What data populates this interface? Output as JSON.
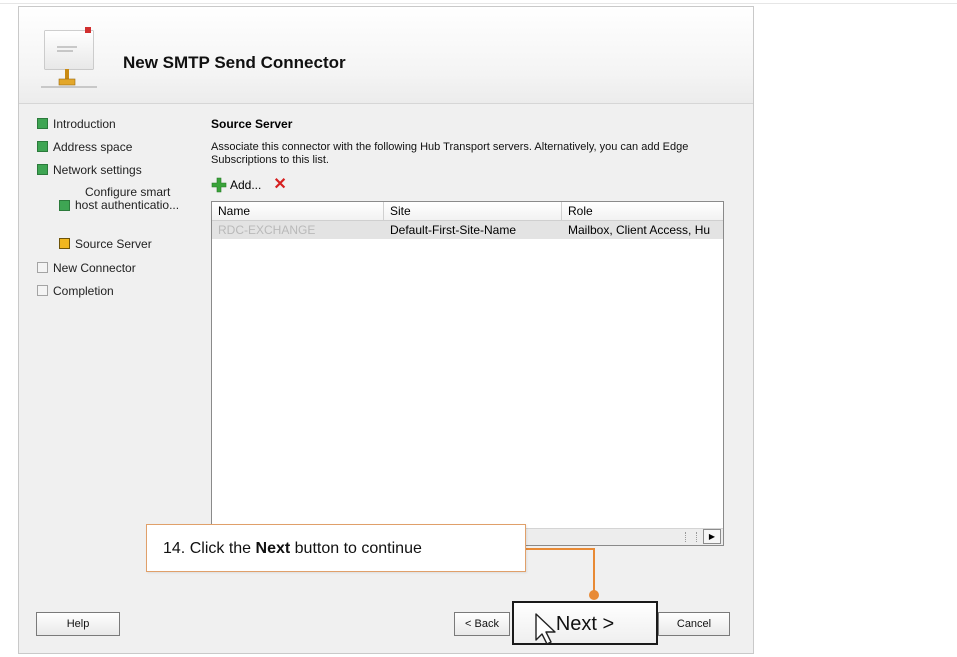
{
  "wizard": {
    "title": "New SMTP Send Connector"
  },
  "nav": {
    "items": [
      {
        "label": "Introduction",
        "state": "done"
      },
      {
        "label": "Address space",
        "state": "done"
      },
      {
        "label": "Network settings",
        "state": "done"
      },
      {
        "label": "Configure smart host authenticatio...",
        "label_line1": "Configure smart",
        "label_line2": "host authenticatio...",
        "state": "done"
      },
      {
        "label": "Source Server",
        "state": "current"
      },
      {
        "label": "New Connector",
        "state": "pending"
      },
      {
        "label": "Completion",
        "state": "pending"
      }
    ]
  },
  "page": {
    "section_title": "Source Server",
    "description": "Associate this connector with the following Hub Transport servers. Alternatively, you can add Edge Subscriptions to this list.",
    "add_label": "Add...",
    "remove_icon": "x-icon",
    "columns": [
      "Name",
      "Site",
      "Role"
    ],
    "rows": [
      {
        "name": "RDC-EXCHANGE",
        "site": "Default-First-Site-Name",
        "role": "Mailbox, Client Access, Hu"
      }
    ]
  },
  "callout": {
    "step": "14.",
    "text_before": "Click the",
    "bold": "Next",
    "text_after": "button to continue"
  },
  "buttons": {
    "help": "Help",
    "back": "< Back",
    "next": "Next >",
    "cancel": "Cancel"
  },
  "colors": {
    "done": "#3ea553",
    "current": "#f1b71f",
    "callout_accent": "#e88a35"
  }
}
